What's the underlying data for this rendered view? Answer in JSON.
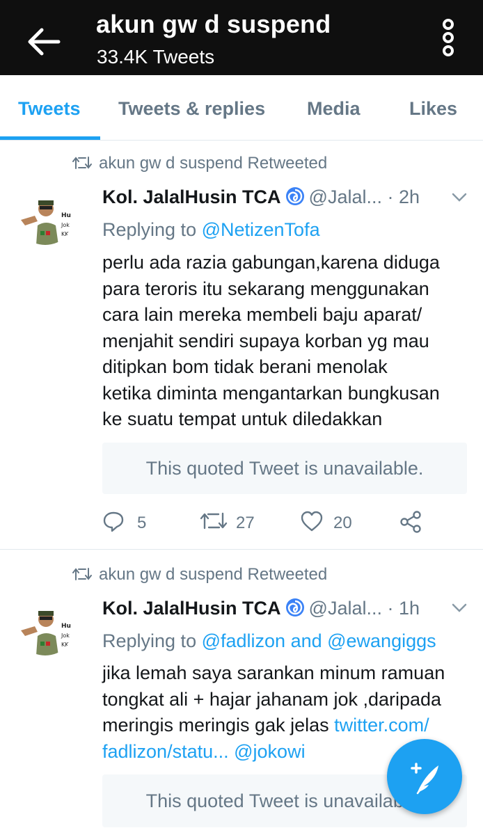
{
  "header": {
    "title": "akun gw d suspend",
    "subtitle": "33.4K Tweets"
  },
  "tabs": [
    {
      "label": "Tweets",
      "active": true
    },
    {
      "label": "Tweets & replies",
      "active": false
    },
    {
      "label": "Media",
      "active": false
    },
    {
      "label": "Likes",
      "active": false
    }
  ],
  "colors": {
    "accent": "#1da1f2",
    "header_bg": "#0f0f0f",
    "muted": "#657786"
  },
  "tweets": [
    {
      "retweet_by": "akun gw d suspend Retweeted",
      "name": "Kol. JalalHusin TCA",
      "handle": "@Jalal...",
      "dot": "·",
      "time": "2h",
      "replying_prefix": "Replying to ",
      "replying_to": "@NetizenTofa",
      "body_lines": [
        "perlu ada razia gabungan,karena diduga",
        "para teroris itu sekarang menggunakan",
        "cara lain mereka membeli baju aparat/",
        "menjahit sendiri supaya korban yg mau",
        "ditipkan bom tidak berani menolak",
        "ketika diminta mengantarkan bungkusan",
        "ke suatu tempat untuk diledakkan"
      ],
      "quoted": "This quoted Tweet is unavailable.",
      "replies": "5",
      "retweets": "27",
      "likes": "20"
    },
    {
      "retweet_by": "akun gw d suspend Retweeted",
      "name": "Kol. JalalHusin TCA",
      "handle": "@Jalal...",
      "dot": "·",
      "time": "1h",
      "replying_prefix": "Replying to ",
      "replying_to": "@fadlizon and @ewangiggs",
      "body_line1": "jika lemah saya sarankan minum ramuan",
      "body_line2": "tongkat ali + hajar jahanam jok ,daripada",
      "body_line3_text": "meringis meringis gak jelas ",
      "body_line3_link": "twitter.com/",
      "body_line4_link": "fadlizon/statu...",
      "body_line4_mention": "@jokowi",
      "quoted": "This quoted Tweet is unavailable."
    }
  ]
}
